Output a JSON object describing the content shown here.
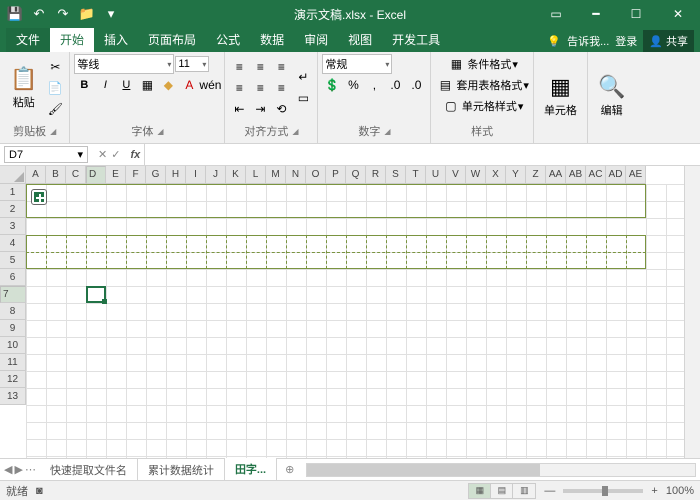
{
  "app_title": "演示文稿.xlsx - Excel",
  "qat": [
    "💾",
    "↶",
    "↷",
    "📁"
  ],
  "tabs": {
    "items": [
      "文件",
      "开始",
      "插入",
      "页面布局",
      "公式",
      "数据",
      "审阅",
      "视图",
      "开发工具"
    ],
    "active": 1,
    "tell_me": "告诉我...",
    "signin": "登录",
    "share": "共享"
  },
  "ribbon": {
    "clipboard": {
      "label": "剪贴板",
      "paste": "粘贴"
    },
    "font": {
      "label": "字体",
      "name": "等线",
      "size": "11"
    },
    "align": {
      "label": "对齐方式"
    },
    "number": {
      "label": "数字",
      "format": "常规"
    },
    "styles": {
      "label": "样式",
      "cond": "条件格式",
      "table": "套用表格格式",
      "cell": "单元格样式"
    },
    "cells": {
      "label": "单元格"
    },
    "editing": {
      "label": "编辑"
    }
  },
  "namebox": "D7",
  "columns": [
    "A",
    "B",
    "C",
    "D",
    "E",
    "F",
    "G",
    "H",
    "I",
    "J",
    "K",
    "L",
    "M",
    "N",
    "O",
    "P",
    "Q",
    "R",
    "S",
    "T",
    "U",
    "V",
    "W",
    "X",
    "Y",
    "Z",
    "AA",
    "AB",
    "AC",
    "AD",
    "AE"
  ],
  "rows": [
    "1",
    "2",
    "3",
    "4",
    "5",
    "6",
    "7",
    "8",
    "9",
    "10",
    "11",
    "12",
    "13"
  ],
  "active_col": 3,
  "active_row": 6,
  "sheets": {
    "items": [
      "快速提取文件名",
      "累计数据统计",
      "田字..."
    ],
    "active": 2
  },
  "status": {
    "ready": "就绪",
    "rec": "",
    "zoom": "100%"
  }
}
